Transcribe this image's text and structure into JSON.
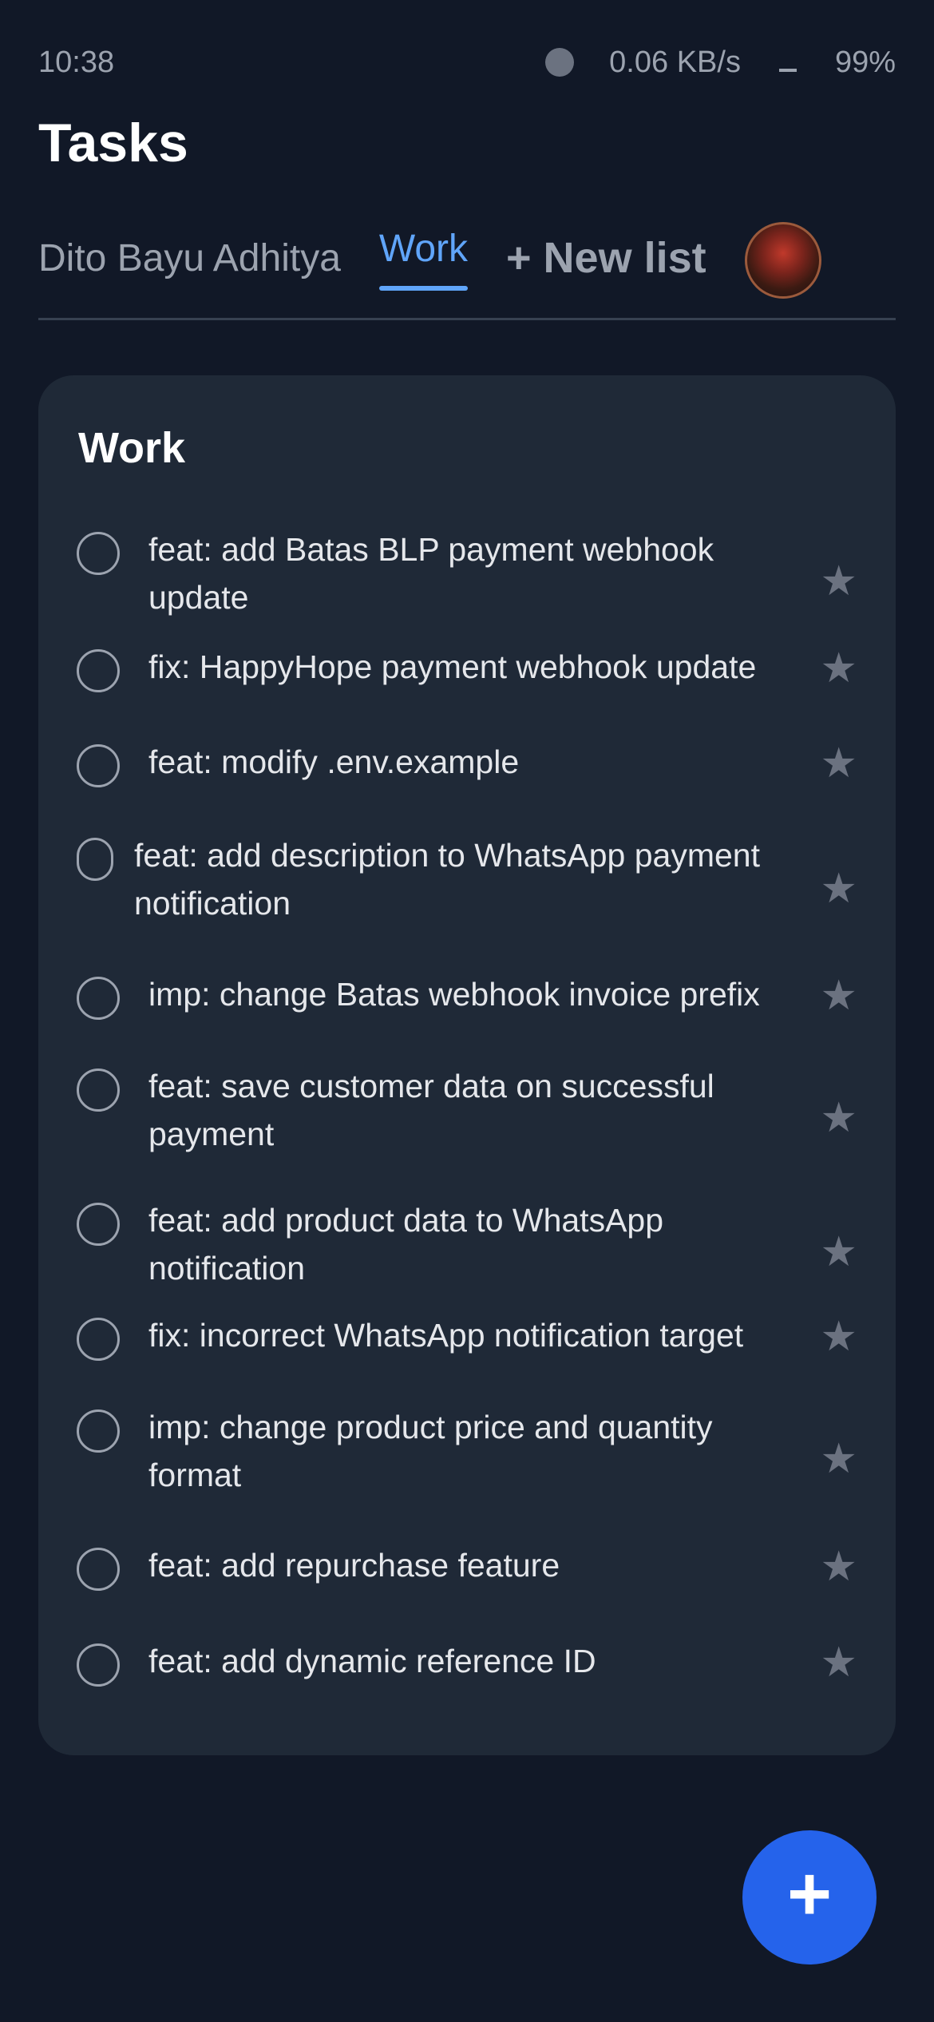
{
  "status": {
    "time": "10:38",
    "network_speed": "0.06 KB/s",
    "battery": "99%"
  },
  "header": {
    "title": "Tasks"
  },
  "tabs": {
    "personal": "Dito Bayu Adhitya",
    "work": "Work",
    "new_list": "+ New list"
  },
  "list": {
    "title": "Work",
    "tasks": [
      {
        "text": "feat: add Batas BLP payment webhook update",
        "starred": false
      },
      {
        "text": "fix: HappyHope payment webhook update",
        "starred": false
      },
      {
        "text": "feat: modify .env.example",
        "starred": false
      },
      {
        "text": "feat: add description to WhatsApp payment notification",
        "starred": false
      },
      {
        "text": "imp: change Batas webhook invoice prefix",
        "starred": false
      },
      {
        "text": "feat: save customer data on successful payment",
        "starred": false
      },
      {
        "text": "feat: add product data to WhatsApp notification",
        "starred": false
      },
      {
        "text": "fix: incorrect WhatsApp notification target",
        "starred": false
      },
      {
        "text": "imp: change product price and quantity format",
        "starred": false
      },
      {
        "text": "feat: add repurchase feature",
        "starred": false
      },
      {
        "text": "feat: add dynamic reference ID",
        "starred": false
      }
    ]
  },
  "fab": {
    "label": "+"
  },
  "icons": {
    "star": "star-icon",
    "checkbox": "circle-checkbox-icon",
    "add": "plus-icon"
  },
  "colors": {
    "background": "#111827",
    "card": "#1f2937",
    "accent": "#60a5fa",
    "fab": "#2563eb"
  }
}
